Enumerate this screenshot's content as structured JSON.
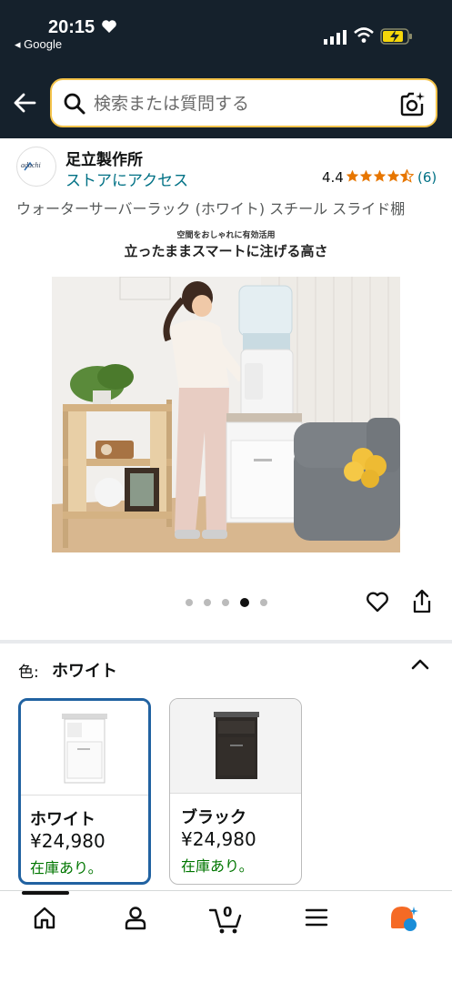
{
  "status_bar": {
    "time": "20:15",
    "back_app": "◂ Google"
  },
  "search": {
    "placeholder": "検索または質問する"
  },
  "store": {
    "logo_text": "adachi",
    "name": "足立製作所",
    "link": "ストアにアクセス",
    "rating": "4.4",
    "rating_count": "(6)",
    "star_value": 4.4
  },
  "product": {
    "title": "ウォーターサーバーラック (ホワイト) スチール スライド棚",
    "image_caption_small": "空間をおしゃれに有効活用",
    "image_caption_big": "立ったままスマートに注げる高さ",
    "carousel_total": 5,
    "carousel_active": 4
  },
  "variation": {
    "label": "色:",
    "selected": "ホワイト",
    "options": [
      {
        "name": "ホワイト",
        "price": "¥24,980",
        "stock": "在庫あり。"
      },
      {
        "name": "ブラック",
        "price": "¥24,980",
        "stock": "在庫あり。"
      }
    ]
  },
  "bottom_nav": {
    "cart_count": "0"
  },
  "colors": {
    "header_bg": "#15212c",
    "search_border": "#f4c34a",
    "link": "#007185",
    "stock": "#007600",
    "star": "#e77600",
    "selected_border": "#2162a1"
  }
}
